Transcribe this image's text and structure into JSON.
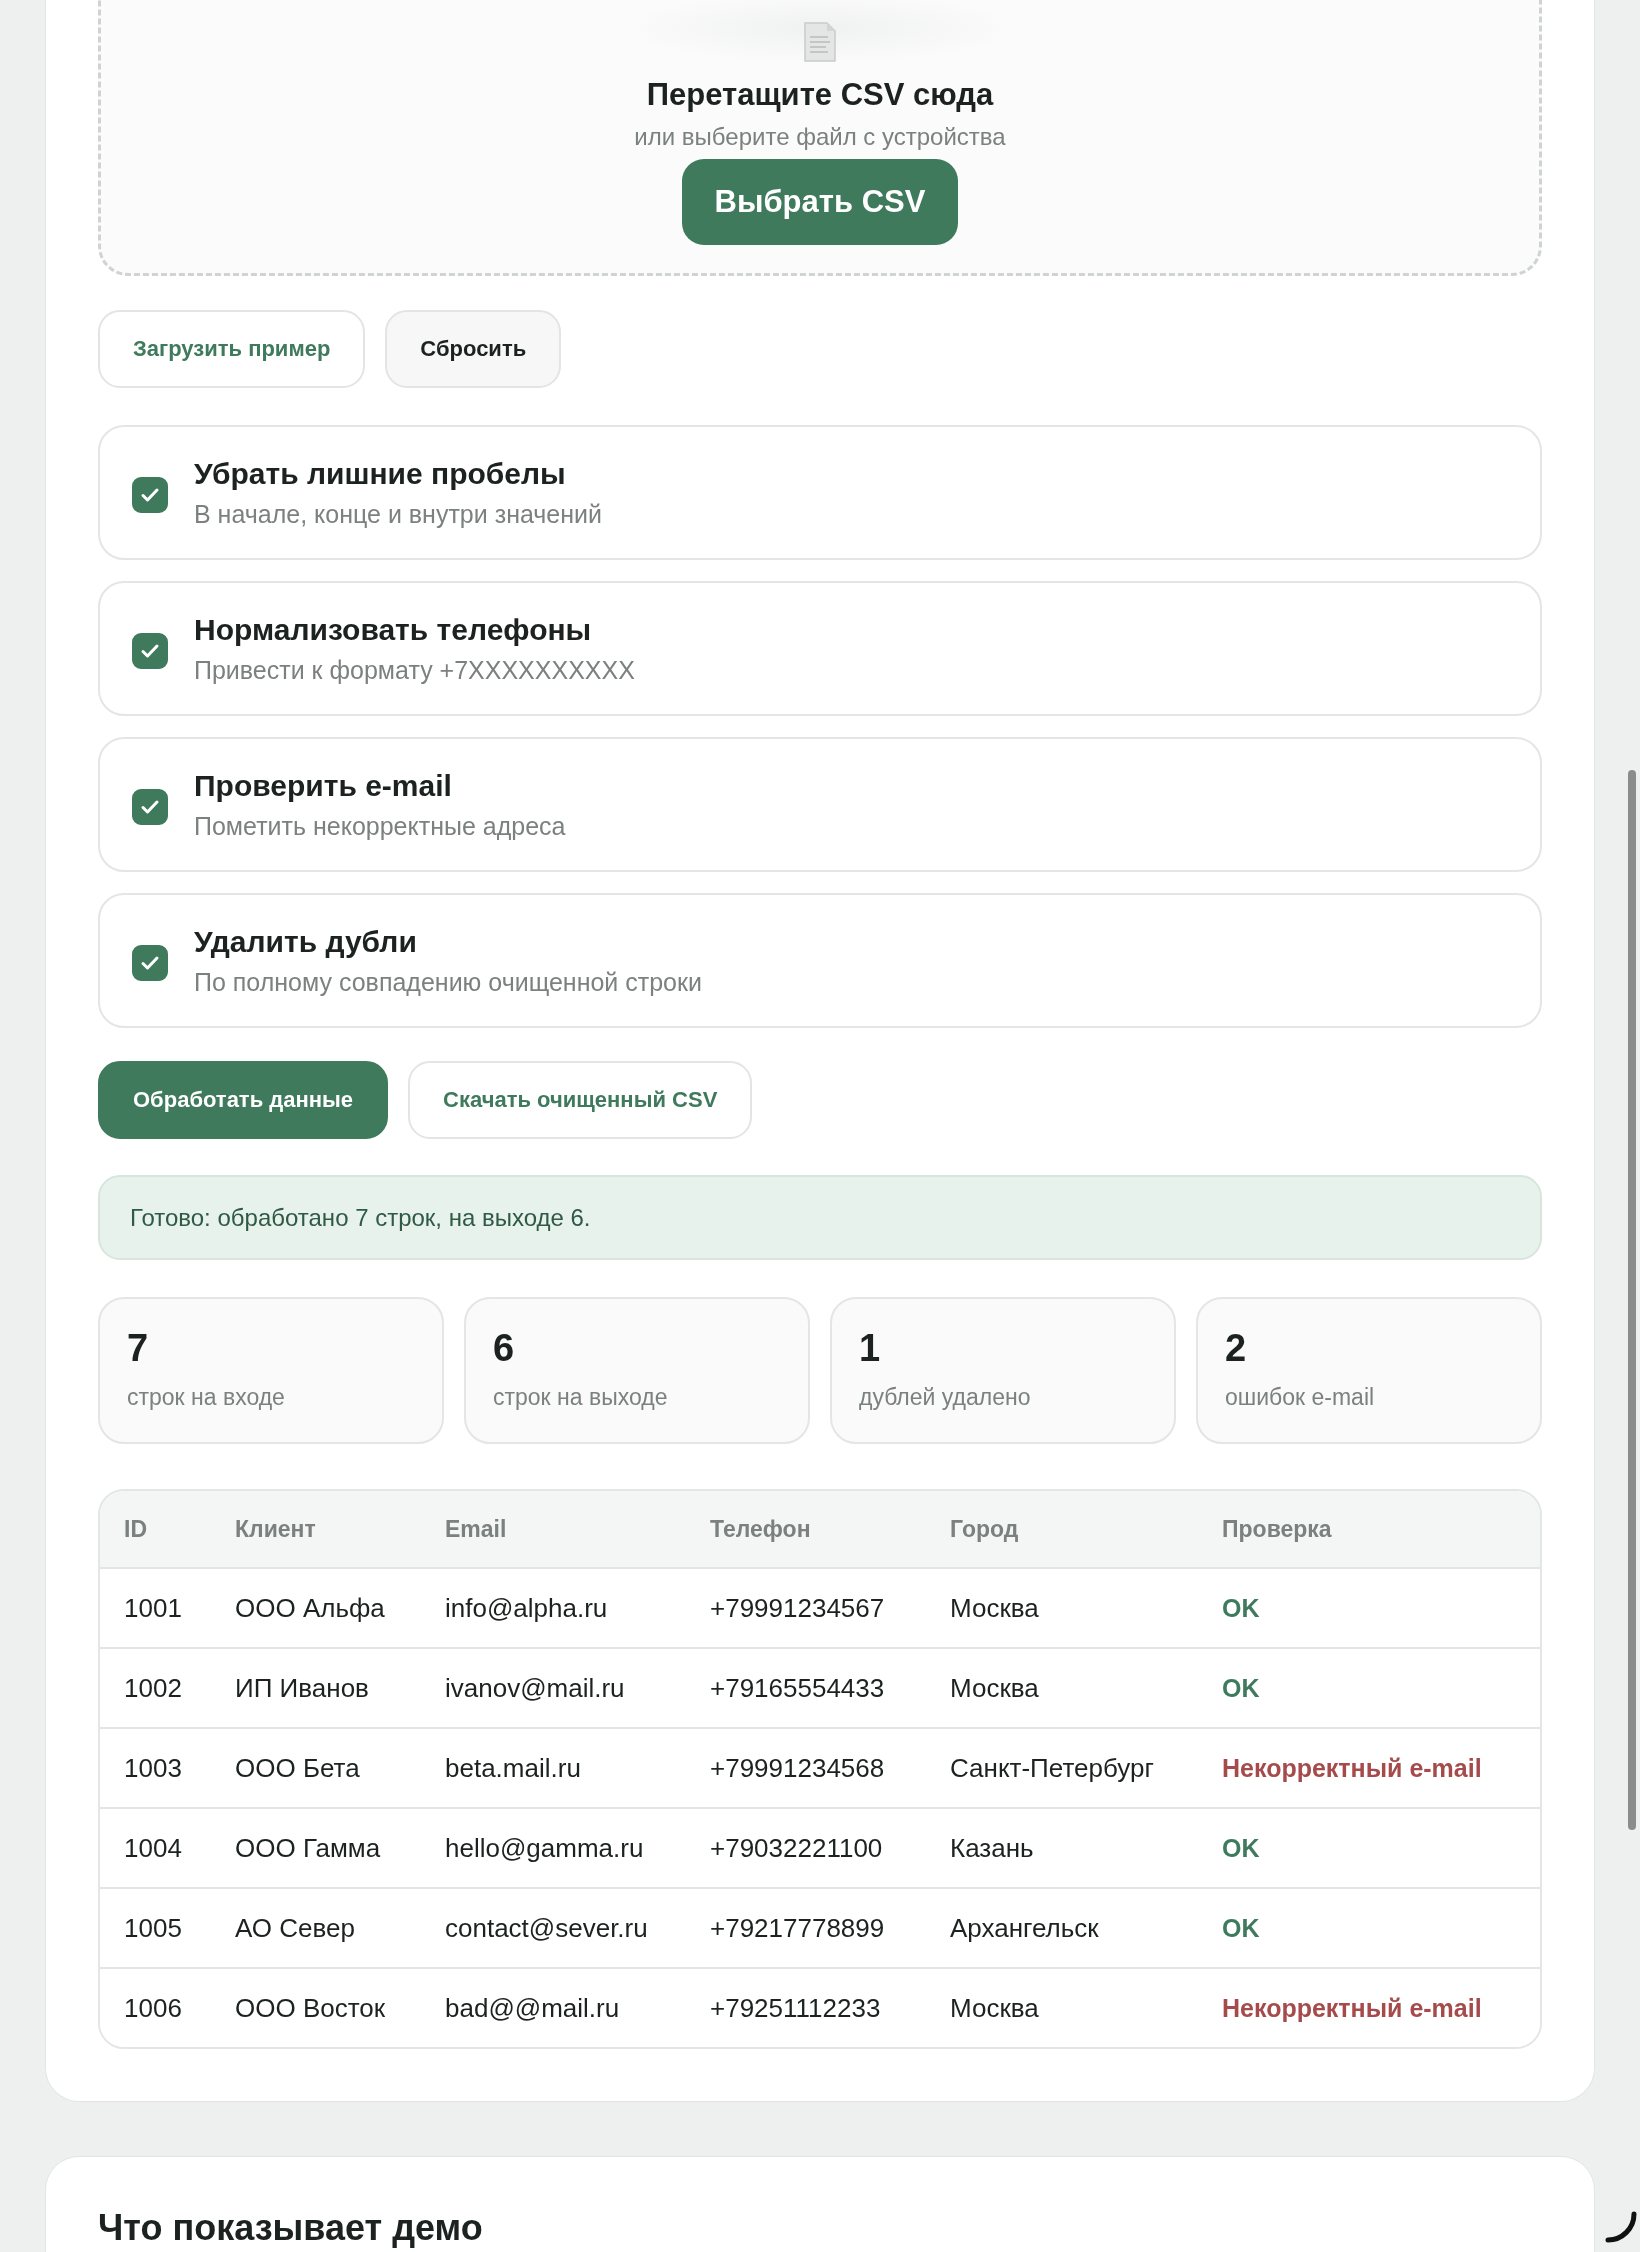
{
  "dropzone": {
    "title": "Перетащите CSV сюда",
    "subtitle": "или выберите файл с устройства",
    "button": "Выбрать CSV"
  },
  "file_buttons": [
    {
      "label": "Загрузить пример",
      "kind": "accent"
    },
    {
      "label": "Сбросить",
      "kind": "neutral"
    }
  ],
  "options": [
    {
      "title": "Убрать лишние пробелы",
      "description": "В начале, конце и внутри значений",
      "checked": true
    },
    {
      "title": "Нормализовать телефоны",
      "description": "Привести к формату +7XXXXXXXXXX",
      "checked": true
    },
    {
      "title": "Проверить e-mail",
      "description": "Пометить некорректные адреса",
      "checked": true
    },
    {
      "title": "Удалить дубли",
      "description": "По полному совпадению очищенной строки",
      "checked": true
    }
  ],
  "actions": [
    {
      "label": "Обработать данные",
      "kind": "primary"
    },
    {
      "label": "Скачать очищенный CSV",
      "kind": "outline"
    }
  ],
  "status": "Готово: обработано 7 строк, на выходе 6.",
  "stats": [
    {
      "value": "7",
      "label": "строк на входе"
    },
    {
      "value": "6",
      "label": "строк на выходе"
    },
    {
      "value": "1",
      "label": "дублей удалено"
    },
    {
      "value": "2",
      "label": "ошибок e-mail"
    }
  ],
  "table": {
    "columns": [
      "ID",
      "Клиент",
      "Email",
      "Телефон",
      "Город",
      "Проверка"
    ],
    "rows": [
      {
        "cells": [
          "1001",
          "ООО Альфа",
          "info@alpha.ru",
          "+79991234567",
          "Москва"
        ],
        "check": "OK",
        "valid": true
      },
      {
        "cells": [
          "1002",
          "ИП Иванов",
          "ivanov@mail.ru",
          "+79165554433",
          "Москва"
        ],
        "check": "OK",
        "valid": true
      },
      {
        "cells": [
          "1003",
          "ООО Бета",
          "beta.mail.ru",
          "+79991234568",
          "Санкт-Петербург"
        ],
        "check": "Некорректный e-mail",
        "valid": false
      },
      {
        "cells": [
          "1004",
          "ООО Гамма",
          "hello@gamma.ru",
          "+79032221100",
          "Казань"
        ],
        "check": "OK",
        "valid": true
      },
      {
        "cells": [
          "1005",
          "АО Север",
          "contact@sever.ru",
          "+79217778899",
          "Архангельск"
        ],
        "check": "OK",
        "valid": true
      },
      {
        "cells": [
          "1006",
          "ООО Восток",
          "bad@@mail.ru",
          "+79251112233",
          "Москва"
        ],
        "check": "Некорректный e-mail",
        "valid": false
      }
    ]
  },
  "next_section": {
    "title": "Что показывает демо"
  }
}
